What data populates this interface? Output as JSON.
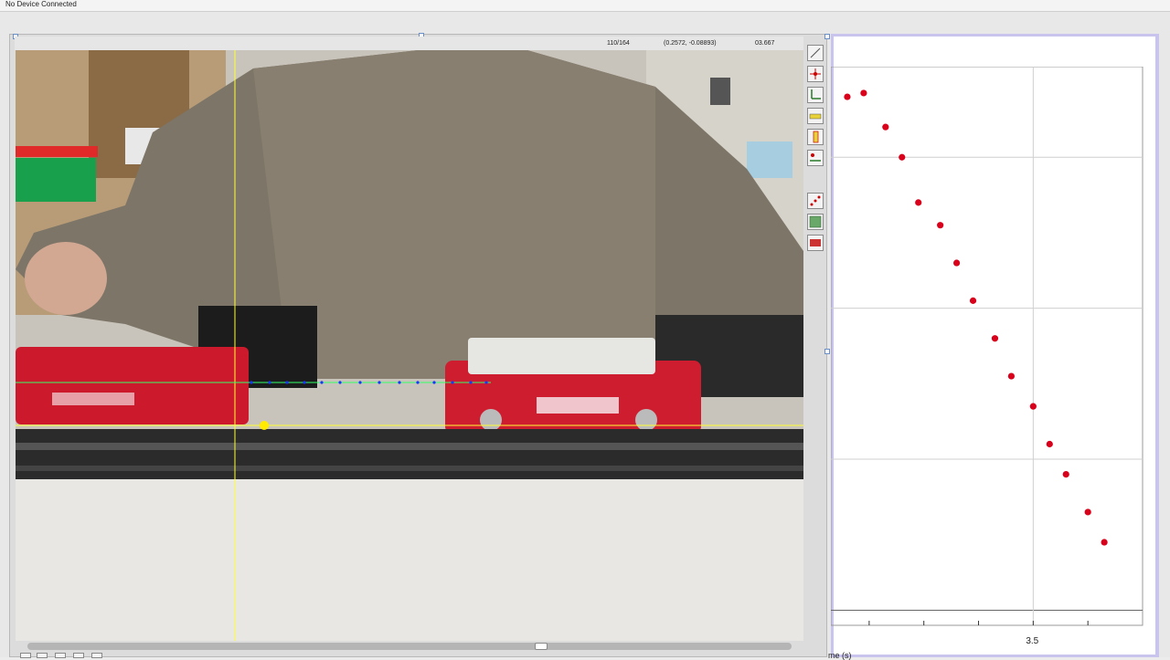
{
  "status": {
    "device": "No Device Connected"
  },
  "video": {
    "frame_counter": "110/164",
    "coordinate_readout": "(0.2572, -0.08893)",
    "time_readout": "03.667"
  },
  "toolbar": {
    "tools": [
      {
        "icon": "calibration-line-icon"
      },
      {
        "icon": "origin-crosshair-icon"
      },
      {
        "icon": "axes-icon"
      },
      {
        "icon": "ruler-icon"
      },
      {
        "icon": "vertical-ruler-icon"
      },
      {
        "icon": "track-points-icon"
      },
      {
        "icon": "scatter-points-icon"
      },
      {
        "icon": "bar-table-icon"
      },
      {
        "icon": "xy-data-icon"
      }
    ]
  },
  "colors": {
    "point": "#d9001b",
    "crosshair": "#ffff33",
    "track": "#1a33ff",
    "origin": "#ffea00",
    "grid": "#cfcfcf",
    "frame_border": "#c9c4ee"
  },
  "chart_data": {
    "type": "scatter",
    "x": [
      3.16,
      3.19,
      3.23,
      3.26,
      3.29,
      3.33,
      3.36,
      3.39,
      3.43,
      3.46,
      3.5,
      3.53,
      3.56,
      3.6,
      3.63
    ],
    "y": [
      0.68,
      0.685,
      0.64,
      0.6,
      0.54,
      0.51,
      0.46,
      0.41,
      0.36,
      0.31,
      0.27,
      0.22,
      0.18,
      0.13,
      0.09
    ],
    "xlim": [
      3.13,
      3.7
    ],
    "ylim": [
      -0.02,
      0.72
    ],
    "xticks": [
      "3.5"
    ],
    "xlabel": "me (s)",
    "grid": true
  }
}
